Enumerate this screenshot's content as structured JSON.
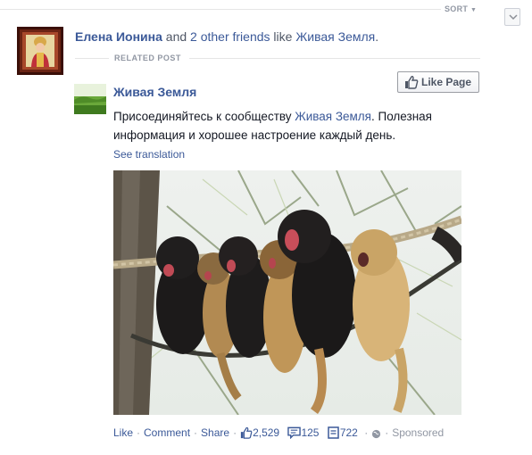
{
  "sort": {
    "label": "SORT",
    "menu_icon": "chevron-down-icon"
  },
  "story": {
    "friend_name": "Елена Ионина",
    "connector": "and",
    "others": "2 other friends",
    "verb": "like",
    "page_link": "Живая Земля",
    "period": "."
  },
  "related_label": "RELATED POST",
  "post": {
    "page_name": "Живая Земля",
    "like_page_label": "Like Page",
    "text_before": "Присоединяйтесь к сообществу ",
    "text_link": "Живая Земля",
    "text_after": ". Полезная информация и хорошее настроение каждый день.",
    "see_translation": "See translation"
  },
  "footer": {
    "like": "Like",
    "comment": "Comment",
    "share": "Share",
    "likes_count": "2,529",
    "comments_count": "125",
    "shares_count": "722",
    "sponsored": "Sponsored"
  },
  "colors": {
    "link": "#3b5998",
    "muted": "#9197a3",
    "text": "#141823"
  }
}
